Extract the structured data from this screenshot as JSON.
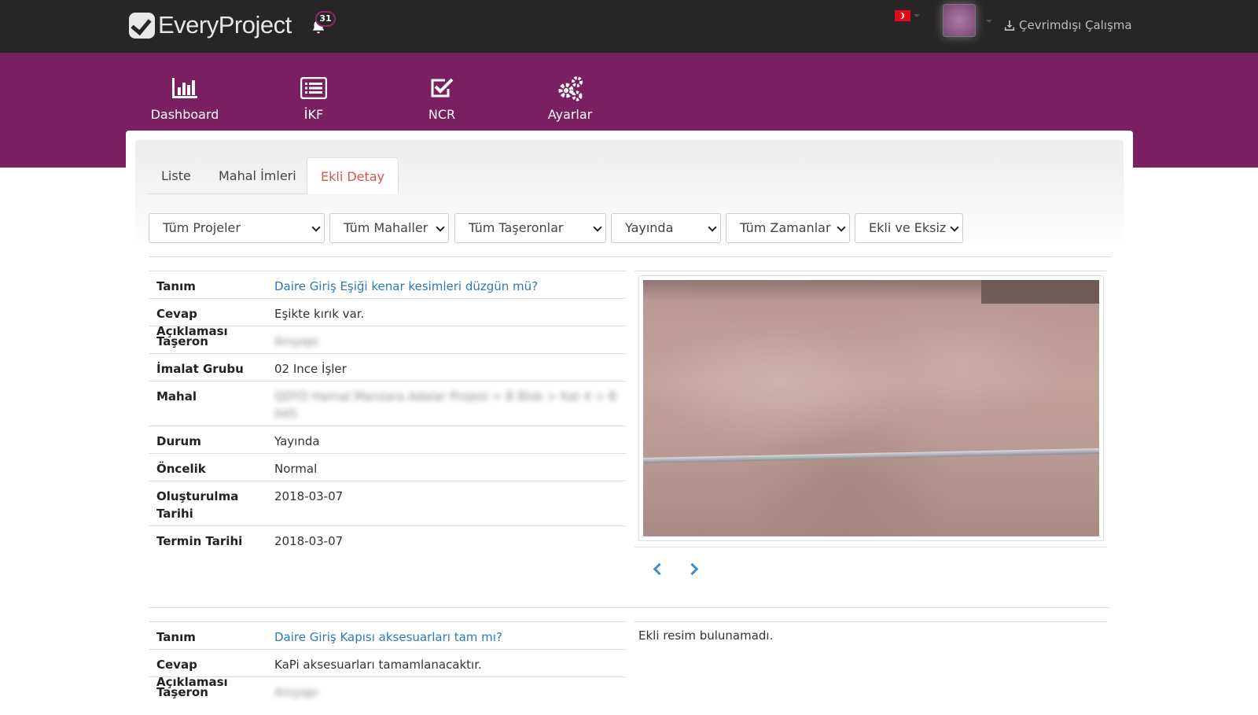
{
  "header": {
    "brand": "EveryProject",
    "notifications_count": "31",
    "offline_label": "Çevrimdışı Çalışma"
  },
  "nav": [
    {
      "label": "Dashboard",
      "icon": "bar-chart-icon"
    },
    {
      "label": "İKF",
      "icon": "list-icon"
    },
    {
      "label": "NCR",
      "icon": "check-square-icon"
    },
    {
      "label": "Ayarlar",
      "icon": "gears-icon"
    }
  ],
  "tabs": [
    "Liste",
    "Mahal İmleri",
    "Ekli Detay"
  ],
  "active_tab": "Ekli Detay",
  "filters": [
    "Tüm Projeler",
    "Tüm Mahaller",
    "Tüm Taşeronlar",
    "Yayında",
    "Tüm Zamanlar",
    "Ekli ve Eksiz"
  ],
  "records": [
    {
      "rows": [
        {
          "label": "Tanım",
          "value": "Daire Giriş Eşiği kenar kesimleri düzgün mü?"
        },
        {
          "label": "Cevap Açıklaması",
          "value": "Eşikte kırık var."
        },
        {
          "label": "Taşeron",
          "value": "Anıyapı"
        },
        {
          "label": "İmalat Grubu",
          "value": "02 Ince İşler"
        },
        {
          "label": "Mahal",
          "value": "QDYD Hamal Manzara Adalar Projesi > B Blok > Kat 4 > B 045"
        },
        {
          "label": "Durum",
          "value": "Yayında"
        },
        {
          "label": "Öncelik",
          "value": "Normal"
        },
        {
          "label": "Oluşturulma Tarihi",
          "value": "2018-03-07"
        },
        {
          "label": "Termin Tarihi",
          "value": "2018-03-07"
        }
      ]
    },
    {
      "rows": [
        {
          "label": "Tanım",
          "value": "Daire Giriş Kapısı aksesuarları tam mı?"
        },
        {
          "label": "Cevap Açıklaması",
          "value": "KaPi aksesuarları tamamlanacaktır."
        },
        {
          "label": "Taşeron",
          "value": "Anıyapı"
        }
      ],
      "no_image_text": "Ekli resim bulunamadı."
    }
  ],
  "colors": {
    "topbar": "#262626",
    "brand_band": "#7a2060",
    "link": "#2a7ab8",
    "active_tab": "#d9534f"
  }
}
